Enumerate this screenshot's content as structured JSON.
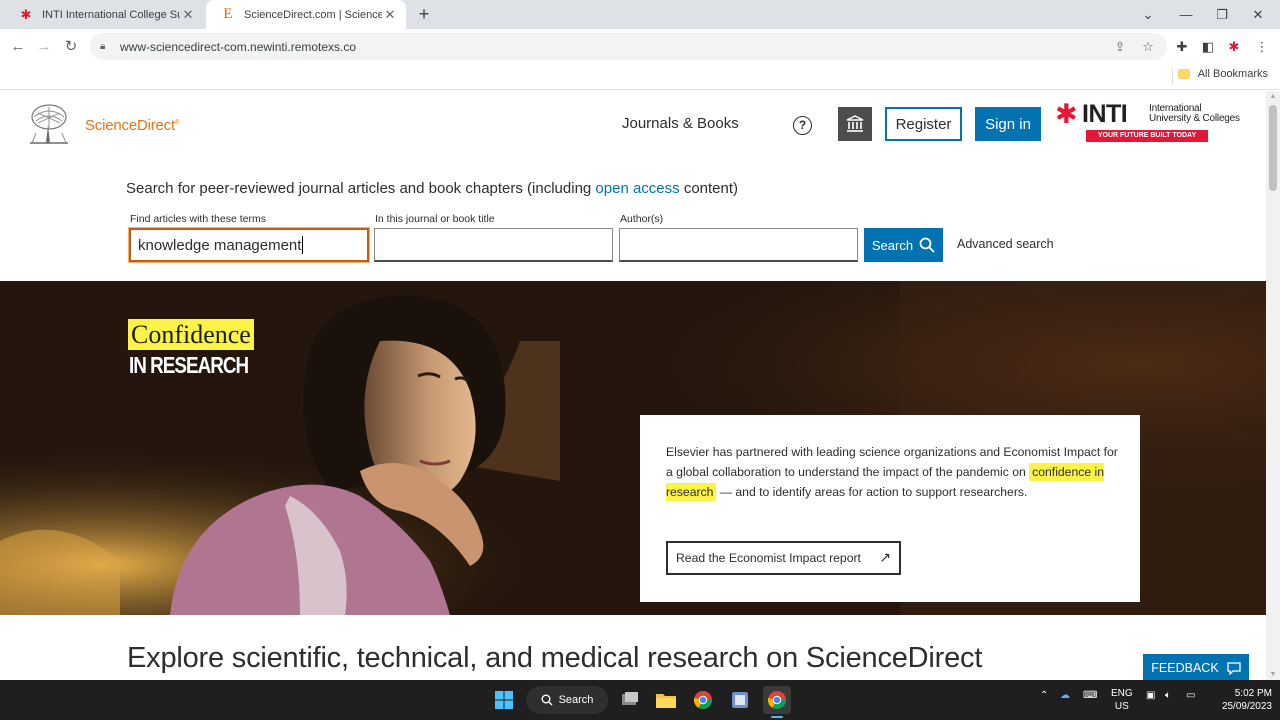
{
  "browser": {
    "tabs": [
      {
        "title": "INTI International College Subang",
        "active": false
      },
      {
        "title": "ScienceDirect.com | Science, health and medical journals",
        "active": true
      }
    ],
    "url": "www-sciencedirect-com.newinti.remotexs.co",
    "bookmarks_label": "All Bookmarks"
  },
  "header": {
    "logo_text": "ScienceDirect",
    "logo_reg": "®",
    "journals_books": "Journals & Books",
    "register": "Register",
    "sign_in": "Sign in",
    "inti": {
      "word": "INTI",
      "line1": "International",
      "line2": "University & Colleges",
      "tag": "YOUR FUTURE BUILT TODAY"
    }
  },
  "search": {
    "heading_pre": "Search for peer-reviewed journal articles and book chapters (including ",
    "heading_link": "open access",
    "heading_post": " content)",
    "terms_label": "Find articles with these terms",
    "terms_value": "knowledge management",
    "journal_label": "In this journal or book title",
    "journal_value": "",
    "author_label": "Author(s)",
    "author_value": "",
    "button": "Search",
    "advanced": "Advanced search"
  },
  "hero": {
    "title_highlight": "Confidence",
    "title_sub": "IN RESEARCH",
    "text_1": "Elsevier has partnered with leading science organizations and Economist Impact for a global collaboration to understand the impact of the pandemic on ",
    "text_highlight": "confidence in research",
    "text_2": " — and to identify areas for action to support researchers.",
    "button": "Read the Economist Impact report"
  },
  "explore_heading": "Explore scientific, technical, and medical research on ScienceDirect",
  "feedback": "FEEDBACK",
  "taskbar": {
    "search": "Search",
    "lang_1": "ENG",
    "lang_2": "US",
    "time": "5:02 PM",
    "date": "25/09/2023"
  },
  "colors": {
    "brand_blue": "#0272b1",
    "sd_orange": "#e9711c",
    "highlight_yellow": "#fbf347",
    "inti_red": "#e31837"
  }
}
